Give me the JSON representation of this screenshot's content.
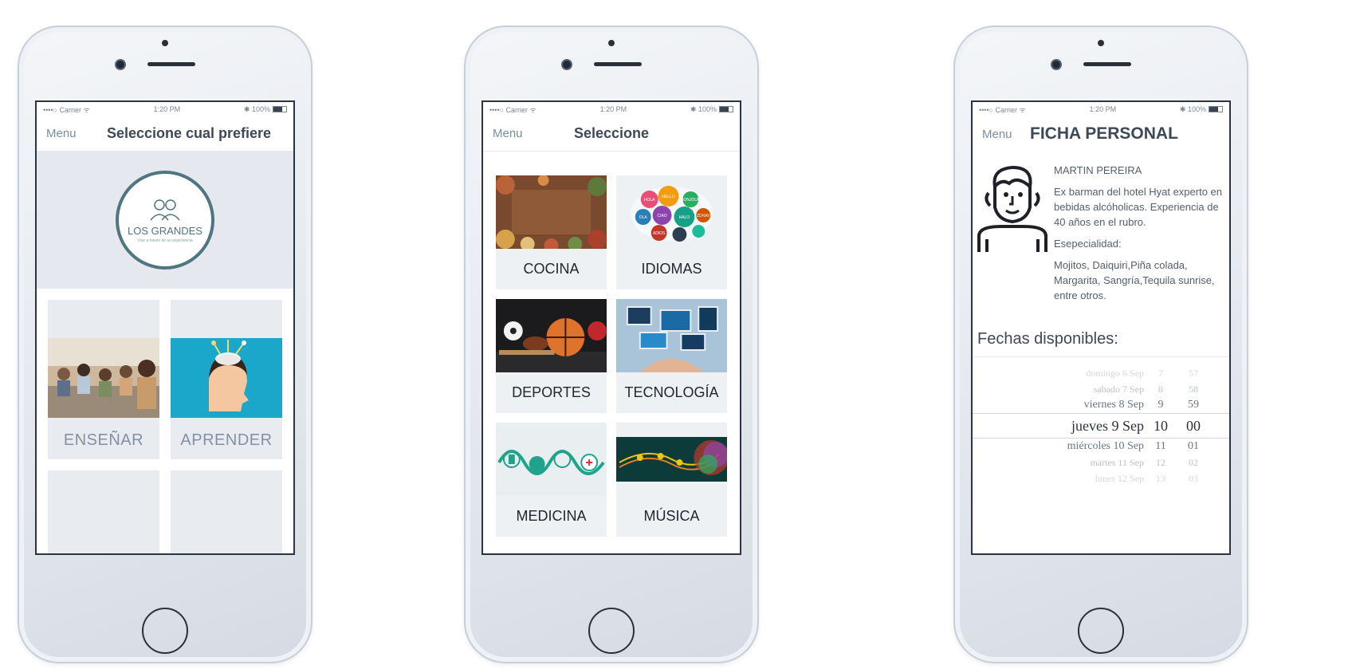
{
  "status": {
    "carrier": "••••○ Carrier ᯤ",
    "time": "1:20 PM",
    "battery": "✱ 100%"
  },
  "phone1": {
    "menu": "Menu",
    "title": "Seleccione cual prefiere",
    "logo_text": "LOS GRANDES",
    "logo_tagline": "Vive a través de su experiencia",
    "options": [
      {
        "label": "ENSEÑAR"
      },
      {
        "label": "APRENDER"
      }
    ]
  },
  "phone2": {
    "menu": "Menu",
    "title": "Seleccione",
    "categories": [
      {
        "label": "COCINA"
      },
      {
        "label": "IDIOMAS"
      },
      {
        "label": "DEPORTES"
      },
      {
        "label": "TECNOLOGÍA"
      },
      {
        "label": "MEDICINA"
      },
      {
        "label": "MÚSICA"
      }
    ],
    "idiomas_words": [
      "HOLA",
      "HELLO",
      "BONJOUR",
      "OLA",
      "CIAO",
      "HALO",
      "ZDRAV",
      "ADIOS"
    ]
  },
  "phone3": {
    "menu": "Menu",
    "title": "FICHA PERSONAL",
    "name": "MARTIN PEREIRA",
    "bio": "Ex barman del hotel Hyat experto en bebidas alcóholicas. Experiencia de 40 años en el rubro.",
    "specialty_label": "Esepecialidad:",
    "specialty": "Mojitos, Daiquiri,Piña colada, Margarita, Sangría,Tequila sunrise, entre otros.",
    "dates_title": "Fechas disponibles:",
    "picker": [
      {
        "day": "domingo 6 Sep",
        "hour": "7",
        "min": "57"
      },
      {
        "day": "sabado 7 Sep",
        "hour": "8",
        "min": "58"
      },
      {
        "day": "viernes 8 Sep",
        "hour": "9",
        "min": "59"
      },
      {
        "day": "jueves 9 Sep",
        "hour": "10",
        "min": "00"
      },
      {
        "day": "miércoles 10 Sep",
        "hour": "11",
        "min": "01"
      },
      {
        "day": "martes 11 Sep",
        "hour": "12",
        "min": "02"
      },
      {
        "day": "lunes 12 Sep",
        "hour": "13",
        "min": "03"
      }
    ]
  },
  "colors": {
    "accent": "#4f7580",
    "card_bg": "#e8ecf1",
    "aprender_bg": "#1aa7c9"
  }
}
